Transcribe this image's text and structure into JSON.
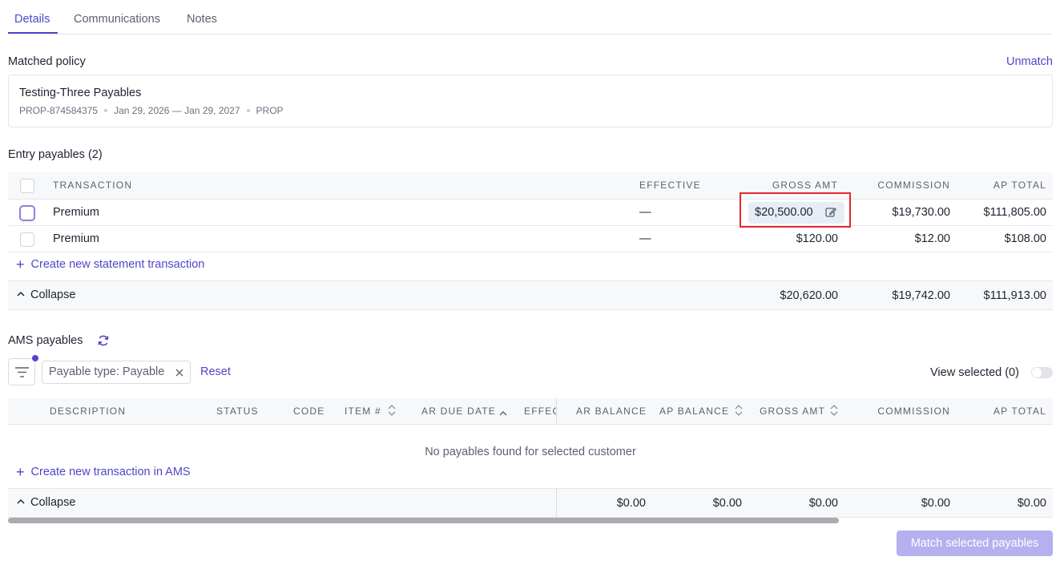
{
  "tabs": [
    {
      "label": "Details",
      "active": true
    },
    {
      "label": "Communications",
      "active": false
    },
    {
      "label": "Notes",
      "active": false
    }
  ],
  "matched_policy": {
    "title": "Matched policy",
    "unmatch_label": "Unmatch",
    "name": "Testing-Three Payables",
    "number": "PROP-874584375",
    "dates": "Jan 29, 2026 — Jan 29, 2027",
    "line": "PROP"
  },
  "entry_payables": {
    "title": "Entry payables (2)",
    "headers": {
      "transaction": "TRANSACTION",
      "effective": "EFFECTIVE",
      "gross": "GROSS AMT",
      "commission": "COMMISSION",
      "ap_total": "AP TOTAL"
    },
    "rows": [
      {
        "transaction": "Premium",
        "effective": "—",
        "gross": "$20,500.00",
        "commission": "$19,730.00",
        "ap_total": "$111,805.00"
      },
      {
        "transaction": "Premium",
        "effective": "—",
        "gross": "$120.00",
        "commission": "$12.00",
        "ap_total": "$108.00"
      }
    ],
    "create_label": "Create new statement transaction",
    "collapse_label": "Collapse",
    "totals": {
      "gross": "$20,620.00",
      "commission": "$19,742.00",
      "ap_total": "$111,913.00"
    }
  },
  "ams_payables": {
    "title": "AMS payables",
    "filter_chip": "Payable type: Payable",
    "reset_label": "Reset",
    "view_selected": "View selected (0)",
    "headers": {
      "description": "DESCRIPTION",
      "status": "STATUS",
      "code": "CODE",
      "item": "ITEM #",
      "ar_due": "AR DUE DATE",
      "effec": "EFFEC",
      "ar_balance": "AR BALANCE",
      "ap_balance": "AP BALANCE",
      "gross": "GROSS AMT",
      "commission": "COMMISSION",
      "ap_total": "AP TOTAL"
    },
    "empty_message": "No payables found for selected customer",
    "create_label": "Create new transaction in AMS",
    "collapse_label": "Collapse",
    "totals": {
      "ar_balance": "$0.00",
      "ap_balance": "$0.00",
      "gross": "$0.00",
      "commission": "$0.00",
      "ap_total": "$0.00"
    }
  },
  "match_button": "Match selected payables",
  "colors": {
    "accent": "#4f46c8",
    "highlight": "#e8262b",
    "disabled_button": "#b5b0ee"
  }
}
